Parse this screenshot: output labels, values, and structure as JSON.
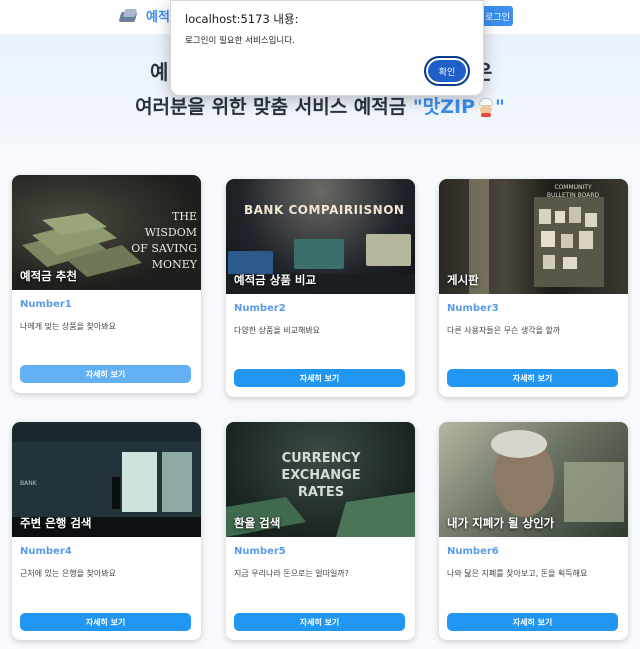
{
  "header": {
    "brand_name": "예적",
    "login_label": "로그인"
  },
  "hero": {
    "line1": "예",
    "line1_suffix": "은",
    "line2_prefix": "여러분을 위한 맞춤 서비스 예적금 ",
    "line2_accent": "\"맛ZIP",
    "line2_close": "\""
  },
  "cards": [
    {
      "image_title": "예적금 추천",
      "number": "Number1",
      "description": "나에게 맞는 상품을 찾아봐요",
      "button": "자세히 보기",
      "image_text": "THE WISDOM OF SAVING MONEY"
    },
    {
      "image_title": "예적금 상품 비교",
      "number": "Number2",
      "description": "다양한 상품을 비교해봐요",
      "button": "자세히 보기",
      "image_text": "BANK COMPAIRIISNON"
    },
    {
      "image_title": "게시판",
      "number": "Number3",
      "description": "다른 사용자들은 무슨 생각을 할까",
      "button": "자세히 보기",
      "image_text": "COMMUNITY BULLETIN BOARD"
    },
    {
      "image_title": "주변 은행 검색",
      "number": "Number4",
      "description": "근처에 있는 은행을 찾아봐요",
      "button": "자세히 보기",
      "image_text": "BANK"
    },
    {
      "image_title": "환율 검색",
      "number": "Number5",
      "description": "지금 우리나라 돈으로는 얼마일까?",
      "button": "자세히 보기",
      "image_text": "CURRENCY EXCHANGE RATES"
    },
    {
      "image_title": "내가 지폐가 될 상인가",
      "number": "Number6",
      "description": "나와 닮은 지폐를 찾아보고, 돈을 획득해요",
      "button": "자세히 보기",
      "image_text": ""
    }
  ],
  "dialog": {
    "title": "localhost:5173 내용:",
    "message": "로그인이 필요한 서비스입니다.",
    "ok_label": "확인"
  },
  "colors": {
    "accent": "#3b8ff0",
    "button": "#2196f3",
    "dialog_ok": "#1f5fc9"
  }
}
